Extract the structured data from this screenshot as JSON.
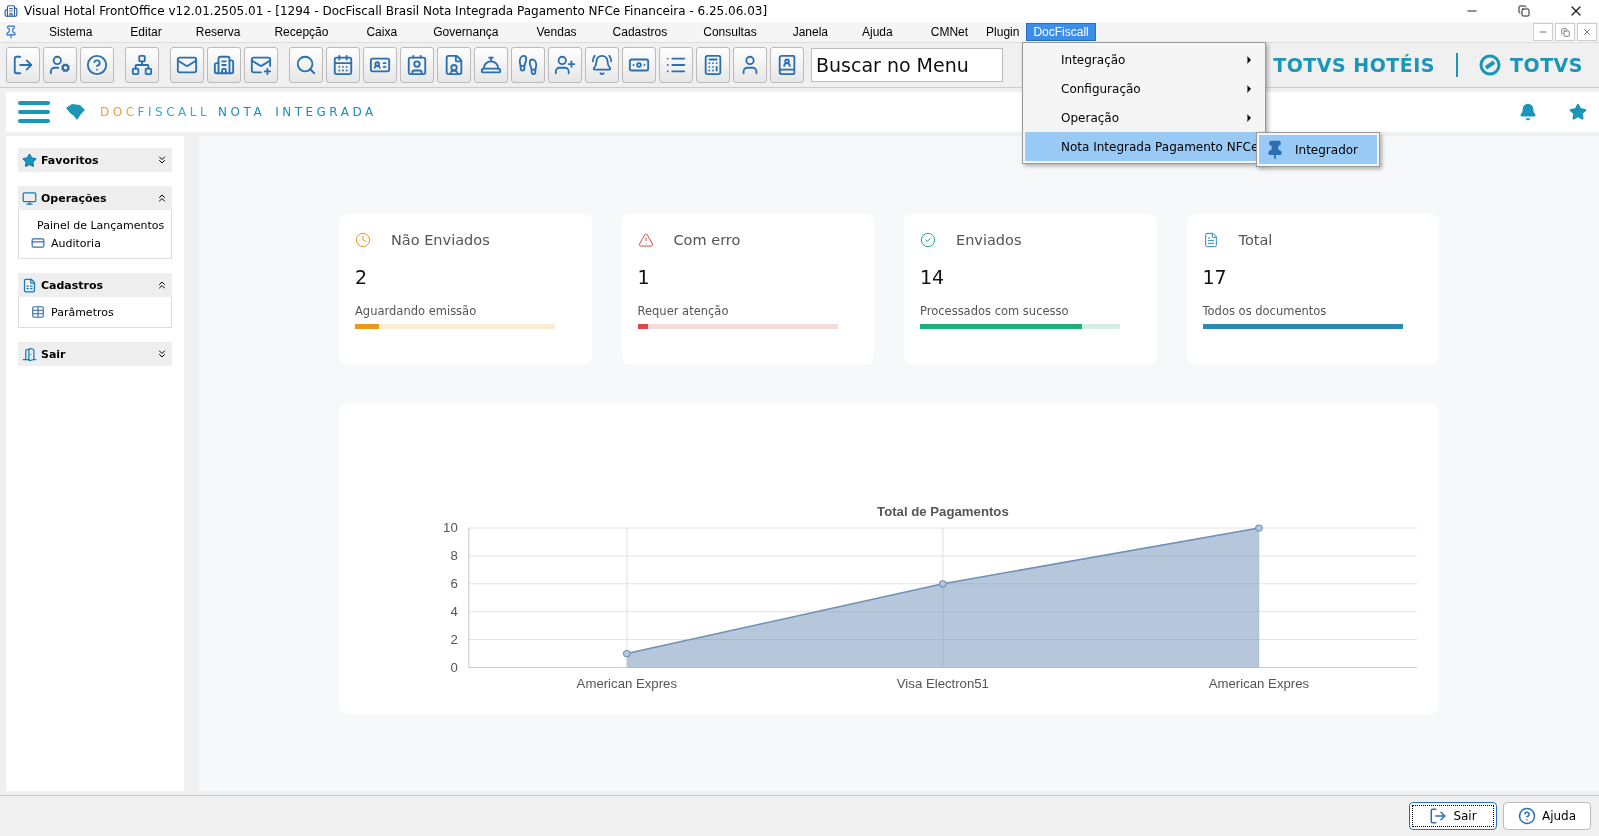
{
  "window": {
    "title": "Visual Hotal FrontOffice v12.01.2505.01 - [1294 - DocFiscall Brasil Nota Integrada Pagamento NFCe Financeira - 6.25.06.03]"
  },
  "menu_bar": {
    "items": [
      {
        "label": "Sistema",
        "selected": false
      },
      {
        "label": "Editar",
        "selected": false
      },
      {
        "label": "Reserva",
        "selected": false
      },
      {
        "label": "Recepção",
        "selected": false
      },
      {
        "label": "Caixa",
        "selected": false
      },
      {
        "label": "Governança",
        "selected": false
      },
      {
        "label": "Vendas",
        "selected": false
      },
      {
        "label": "Cadastros",
        "selected": false
      },
      {
        "label": "Consultas",
        "selected": false
      },
      {
        "label": "Janela",
        "selected": false
      },
      {
        "label": "Ajuda",
        "selected": false
      },
      {
        "label": "CMNet",
        "selected": false
      },
      {
        "label": "Plugin",
        "selected": false
      },
      {
        "label": "DocFiscall",
        "selected": true
      }
    ]
  },
  "toolbar": {
    "search": {
      "placeholder": "Buscar no Menu"
    },
    "brand": "TOTVS HOTÉIS",
    "logo": "TOTVS"
  },
  "dropdown": {
    "items": [
      {
        "label": "Integração",
        "selected": false
      },
      {
        "label": "Configuração",
        "selected": false
      },
      {
        "label": "Operação",
        "selected": false
      },
      {
        "label": "Nota Integrada Pagamento NFCe",
        "selected": true
      }
    ],
    "submenu": [
      {
        "label": "Integrador",
        "selected": true
      }
    ]
  },
  "app_header": {
    "logo": [
      {
        "text": "DOC",
        "color": "#f0a040"
      },
      {
        "text": "FISCALL",
        "color": "#3aa8c8"
      },
      {
        "text": "NOTA",
        "color": "#1a8fb8"
      },
      {
        "text": "INTEGRADA",
        "color": "#1a8fb8"
      }
    ]
  },
  "sidebar": [
    {
      "title": "Favoritos",
      "expanded": false
    },
    {
      "title": "Operações",
      "expanded": true,
      "items": [
        {
          "label": "Painel de Lançamentos"
        },
        {
          "label": "Auditoria"
        }
      ]
    },
    {
      "title": "Cadastros",
      "expanded": true,
      "items": [
        {
          "label": "Parâmetros"
        }
      ]
    },
    {
      "title": "Sair",
      "expanded": false
    }
  ],
  "cards": [
    {
      "kind": "pending",
      "title": "Não Enviados",
      "value": "2",
      "caption": "Aguardando emissão",
      "level": 0.12,
      "color": "#e89a1a"
    },
    {
      "kind": "error",
      "title": "Com erro",
      "value": "1",
      "caption": "Requer atenção",
      "level": 0.05,
      "color": "#e04848"
    },
    {
      "kind": "sent",
      "title": "Enviados",
      "value": "14",
      "caption": "Processados com sucesso",
      "level": 0.81,
      "color": "#1fb07a"
    },
    {
      "kind": "total",
      "title": "Total",
      "value": "17",
      "caption": "Todos os documentos",
      "level": 1,
      "color": "#2a8ab0"
    }
  ],
  "chart": {
    "chart_data": {
      "type": "area",
      "title": "Total de Pagamentos",
      "categories": [
        "American Expres",
        "Visa Electron51",
        "American Expres"
      ],
      "series": [
        {
          "color": "#6f8fb8",
          "values": [
            1,
            6,
            10
          ]
        }
      ],
      "ylim": [
        0,
        10
      ],
      "yticks": [
        0,
        2,
        4,
        6,
        8,
        10
      ],
      "grid": true
    }
  },
  "footer": {
    "buttons": [
      {
        "kind": "exit",
        "label": "Sair",
        "focused": true
      },
      {
        "kind": "help",
        "label": "Ajuda",
        "focused": false
      }
    ]
  }
}
